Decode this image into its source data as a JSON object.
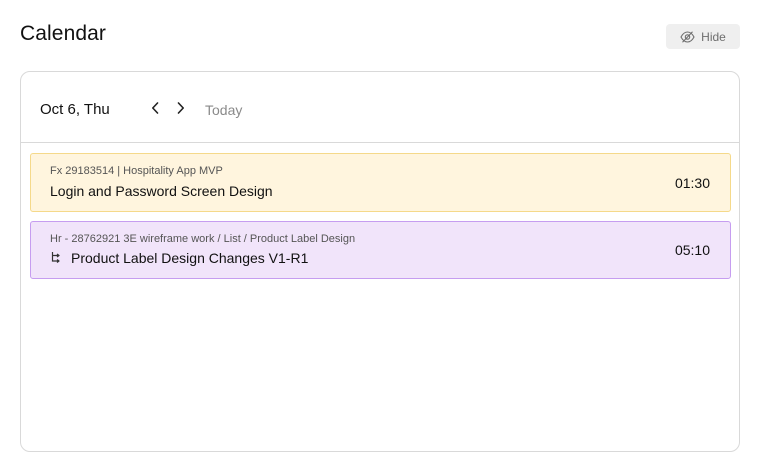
{
  "header": {
    "title": "Calendar",
    "hide_label": "Hide",
    "hide_icon": "eye-off-icon"
  },
  "calendar": {
    "date_label": "Oct 6, Thu",
    "prev_icon": "chevron-left-icon",
    "next_icon": "chevron-right-icon",
    "today_label": "Today"
  },
  "events": [
    {
      "meta": "Fx 29183514 | Hospitality App MVP",
      "title": "Login and Password Screen Design",
      "time": "01:30",
      "background": "#fff5de",
      "border": "#f5d98a"
    },
    {
      "meta": "Hr - 28762921 3E wireframe work / List / Product Label Design",
      "title": "Product Label Design Changes V1-R1",
      "time": "05:10",
      "icon": "subtask-icon",
      "background": "#f1e4fa",
      "border": "#c69df0"
    }
  ]
}
